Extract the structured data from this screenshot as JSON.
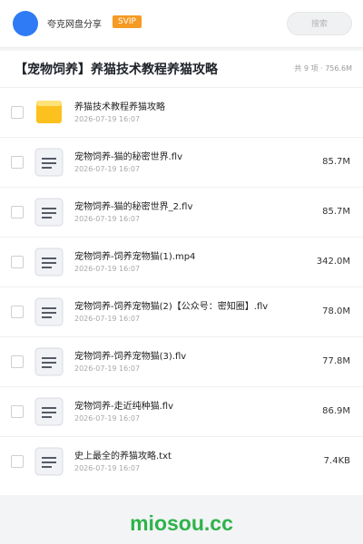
{
  "header": {
    "share_title": "夸克网盘分享",
    "badge": "SVIP",
    "search_placeholder": "搜索"
  },
  "folder": {
    "title": "【宠物饲养】养猫技术教程养猫攻略",
    "meta": "共 9 项 · 756.6M"
  },
  "files": [
    {
      "type": "folder",
      "name": "养猫技术教程养猫攻略",
      "date": "2026-07-19 16:07",
      "size": ""
    },
    {
      "type": "file",
      "name": "宠物饲养-猫的秘密世界.flv",
      "date": "2026-07-19 16:07",
      "size": "85.7M"
    },
    {
      "type": "file",
      "name": "宠物饲养-猫的秘密世界_2.flv",
      "date": "2026-07-19 16:07",
      "size": "85.7M"
    },
    {
      "type": "file",
      "name": "宠物饲养-饲养宠物猫(1).mp4",
      "date": "2026-07-19 16:07",
      "size": "342.0M"
    },
    {
      "type": "file",
      "name": "宠物饲养-饲养宠物猫(2)【公众号：密知圈】.flv",
      "date": "2026-07-19 16:07",
      "size": "78.0M"
    },
    {
      "type": "file",
      "name": "宠物饲养-饲养宠物猫(3).flv",
      "date": "2026-07-19 16:07",
      "size": "77.8M"
    },
    {
      "type": "file",
      "name": "宠物饲养-走近纯种猫.flv",
      "date": "2026-07-19 16:07",
      "size": "86.9M"
    },
    {
      "type": "file",
      "name": "史上最全的养猫攻略.txt",
      "date": "2026-07-19 16:07",
      "size": "7.4KB"
    }
  ],
  "watermark": "miosou.cc",
  "colors": {
    "accent_blue": "#2f7bf5",
    "badge_orange": "#f59a23",
    "folder_yellow": "#fcc11f",
    "watermark_green": "#2fb34a"
  }
}
